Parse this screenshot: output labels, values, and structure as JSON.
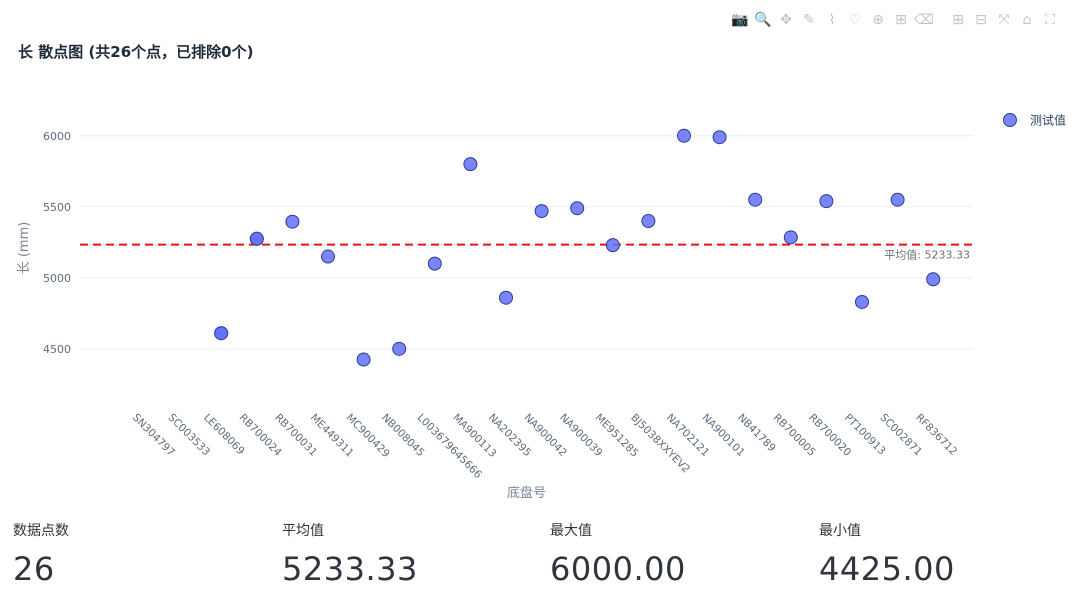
{
  "page": {
    "title": "长 散点图 (共26个点，已排除0个)"
  },
  "toolbar": {
    "buttons": [
      {
        "name": "camera-icon",
        "glyph": "📷"
      },
      {
        "name": "zoom-icon",
        "glyph": "🔍"
      },
      {
        "name": "pan-icon",
        "glyph": "✥"
      },
      {
        "name": "draw-line-icon",
        "glyph": "✎"
      },
      {
        "name": "draw-open-path-icon",
        "glyph": "⌇"
      },
      {
        "name": "draw-closed-path-icon",
        "glyph": "♡"
      },
      {
        "name": "draw-circle-icon",
        "glyph": "⊕"
      },
      {
        "name": "draw-rect-icon",
        "glyph": "⊞"
      },
      {
        "name": "erase-shape-icon",
        "glyph": "⌫"
      },
      {
        "name": "zoom-in-icon",
        "glyph": "⊞"
      },
      {
        "name": "zoom-out-icon",
        "glyph": "⊟"
      },
      {
        "name": "autoscale-icon",
        "glyph": "⤧"
      },
      {
        "name": "reset-axes-icon",
        "glyph": "⌂"
      },
      {
        "name": "fullscreen-icon",
        "glyph": "⛶"
      }
    ]
  },
  "chart_data": {
    "type": "scatter",
    "title": "长 散点图 (共26个点，已排除0个)",
    "xlabel": "底盘号",
    "ylabel": "长 (mm)",
    "ylim": [
      4140,
      6280
    ],
    "yticks": [
      4500,
      5000,
      5500,
      6000
    ],
    "grid": true,
    "legend_position": "top-right",
    "categories": [
      "SN304797",
      "SC003533",
      "LE608069",
      "RB700024",
      "RB700031",
      "ME449311",
      "MC900429",
      "NB008045",
      "L003679645666",
      "MA900113",
      "NA202395",
      "NA900042",
      "NA900039",
      "ME951285",
      "BJ5038XXYEV2",
      "NA702121",
      "NA900101",
      "NB41789",
      "RB700005",
      "RB700020",
      "PT100913",
      "SC002871",
      "RF836712"
    ],
    "series": [
      {
        "name": "测试值",
        "color": "#636efa",
        "points": [
          {
            "x": "LE608069",
            "y": 4610
          },
          {
            "x": "LE608069",
            "y": 4610
          },
          {
            "x": "RB700024",
            "y": 5275
          },
          {
            "x": "RB700024",
            "y": 5275
          },
          {
            "x": "RB700031",
            "y": 5395
          },
          {
            "x": "ME449311",
            "y": 5150
          },
          {
            "x": "MC900429",
            "y": 4425
          },
          {
            "x": "NB008045",
            "y": 4500
          },
          {
            "x": "L003679645666",
            "y": 5100
          },
          {
            "x": "MA900113",
            "y": 5800
          },
          {
            "x": "NA202395",
            "y": 4860
          },
          {
            "x": "NA900042",
            "y": 5470
          },
          {
            "x": "NA900039",
            "y": 5490
          },
          {
            "x": "ME951285",
            "y": 5230
          },
          {
            "x": "BJ5038XXYEV2",
            "y": 5400
          },
          {
            "x": "NA702121",
            "y": 6000
          },
          {
            "x": "NA900101",
            "y": 5990
          },
          {
            "x": "NB41789",
            "y": 5550
          },
          {
            "x": "RB700005",
            "y": 5285
          },
          {
            "x": "RB700020",
            "y": 5540
          },
          {
            "x": "PT100913",
            "y": 4830
          },
          {
            "x": "SC002871",
            "y": 5550
          },
          {
            "x": "RF836712",
            "y": 4990
          }
        ]
      }
    ],
    "mean_line": {
      "value": 5233.33,
      "label": "平均值: 5233.33",
      "color": "#ee1111"
    }
  },
  "metrics": [
    {
      "label": "数据点数",
      "value": "26"
    },
    {
      "label": "平均值",
      "value": "5233.33"
    },
    {
      "label": "最大值",
      "value": "6000.00"
    },
    {
      "label": "最小值",
      "value": "4425.00"
    }
  ]
}
